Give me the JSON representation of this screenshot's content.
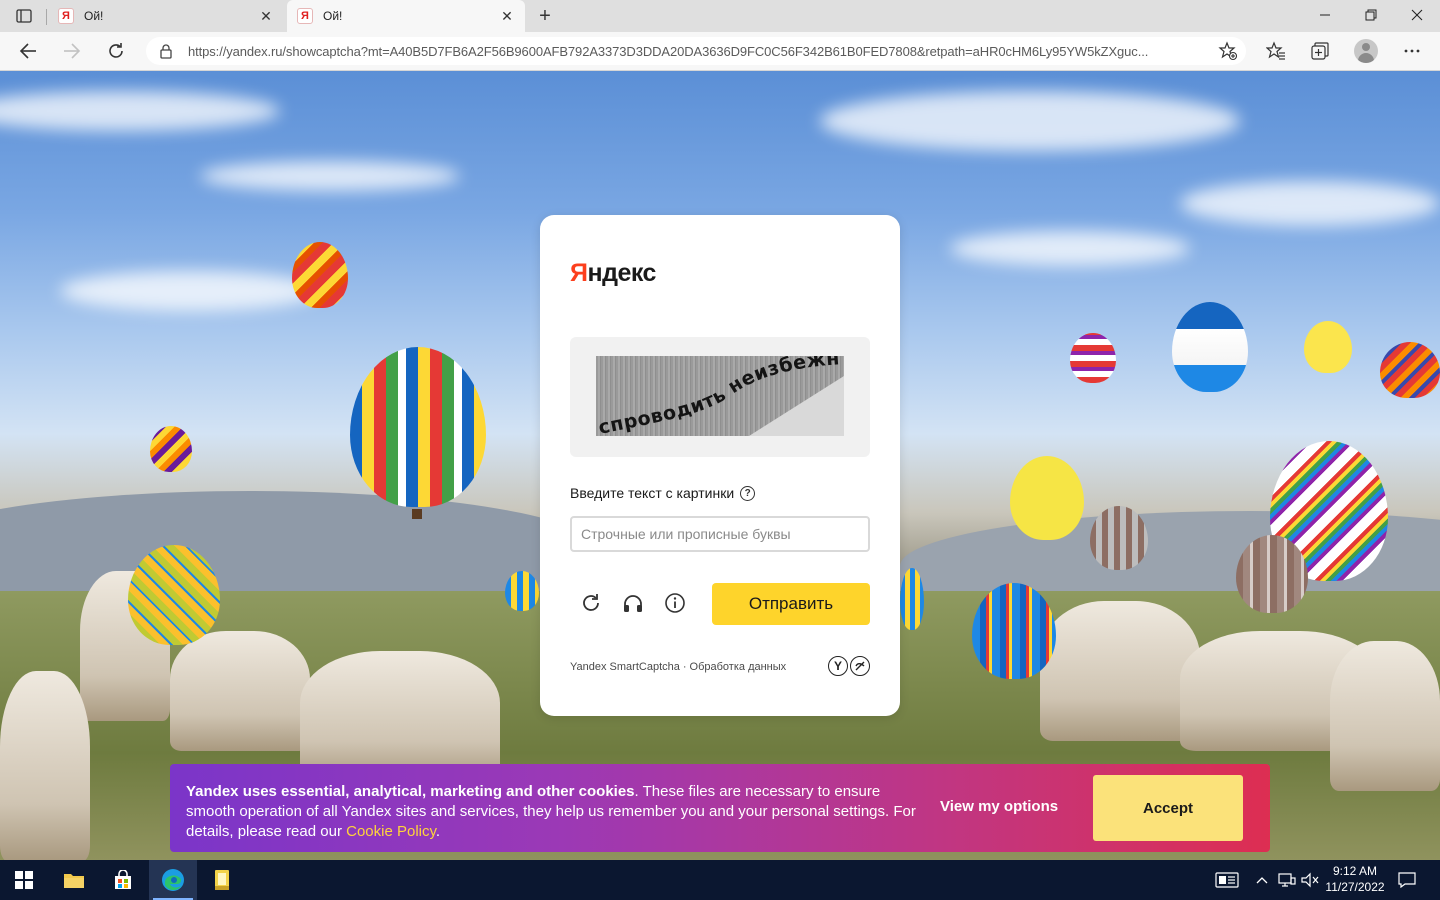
{
  "browser": {
    "tabs": [
      {
        "title": "Ой!",
        "favicon": "Я",
        "active": false
      },
      {
        "title": "Ой!",
        "favicon": "Я",
        "active": true
      }
    ],
    "url": "https://yandex.ru/showcaptcha?mt=A40B5D7FB6A2F56B9600AFB792A3373D3DDA20DA3636D9FC0C56F342B61B0FED7808&retpath=aHR0cHM6Ly95YW5kZXguc..."
  },
  "card": {
    "brand_first": "Я",
    "brand_rest": "ндекс",
    "captcha_text": "спроводить неизбежно",
    "prompt": "Введите текст с картинки",
    "help_symbol": "?",
    "input_placeholder": "Строчные или прописные буквы",
    "input_value": "",
    "submit_label": "Отправить",
    "footer_product": "Yandex SmartCaptcha",
    "footer_separator": "·",
    "footer_link": "Обработка данных"
  },
  "cookie_banner": {
    "bold_text": "Yandex uses essential, analytical, marketing and other cookies",
    "text": ". These files are necessary to ensure smooth operation of all Yandex sites and services, they help us remember you and your personal settings. For details, please read our ",
    "link_text": "Cookie Policy",
    "end_text": ".",
    "view_options_label": "View my options",
    "accept_label": "Accept"
  },
  "taskbar": {
    "time": "9:12 AM",
    "date": "11/27/2022"
  },
  "colors": {
    "yandex_red": "#fc3f1d",
    "submit_yellow": "#fed42b",
    "accept_yellow": "#fbe27a",
    "banner_start": "#7b35c9",
    "banner_end": "#dd2e52"
  },
  "icons": [
    "tab-actions-icon",
    "close-icon",
    "plus-icon",
    "minimize-icon",
    "maximize-icon",
    "back-icon",
    "forward-icon",
    "refresh-icon",
    "lock-icon",
    "favorite-add-icon",
    "favorites-icon",
    "collections-icon",
    "avatar",
    "more-icon",
    "refresh-captcha-icon",
    "headphones-icon",
    "info-icon",
    "windows-start-icon",
    "file-explorer-icon",
    "store-icon",
    "edge-icon",
    "app-icon",
    "news-icon",
    "chevron-up-icon",
    "network-icon",
    "volume-icon",
    "notification-icon"
  ]
}
